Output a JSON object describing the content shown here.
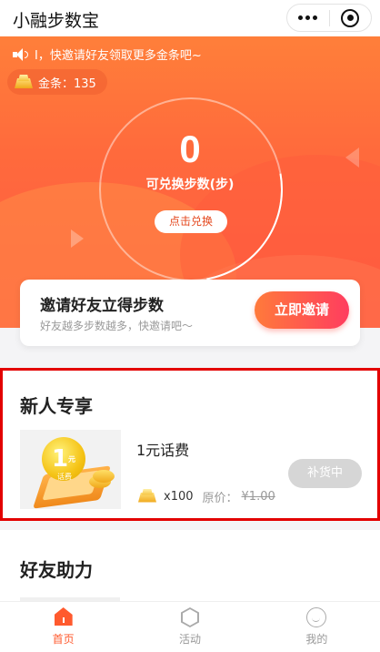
{
  "header": {
    "title": "小融步数宝"
  },
  "hero": {
    "notice": "I，快邀请好友领取更多金条吧~",
    "gold_label": "金条：135",
    "steps": "0",
    "steps_label": "可兑换步数(步)",
    "redeem_label": "点击兑换"
  },
  "invite": {
    "title": "邀请好友立得步数",
    "subtitle": "好友越多步数越多，快邀请吧～",
    "button": "立即邀请"
  },
  "newbie": {
    "title": "新人专享",
    "product": {
      "image_text": "1",
      "image_unit": "元",
      "image_label": "话费",
      "name": "1元话费",
      "gold_cost": "x100",
      "original_label": "原价：",
      "original_price": "¥1.00",
      "status": "补货中"
    }
  },
  "friends": {
    "title": "好友助力"
  },
  "tabbar": {
    "items": [
      {
        "label": "首页",
        "icon": "home-icon",
        "active": true
      },
      {
        "label": "活动",
        "icon": "activity-icon",
        "active": false
      },
      {
        "label": "我的",
        "icon": "profile-icon",
        "active": false
      }
    ]
  },
  "colors": {
    "accent": "#ff5a2e",
    "highlight_frame": "#e30000"
  }
}
